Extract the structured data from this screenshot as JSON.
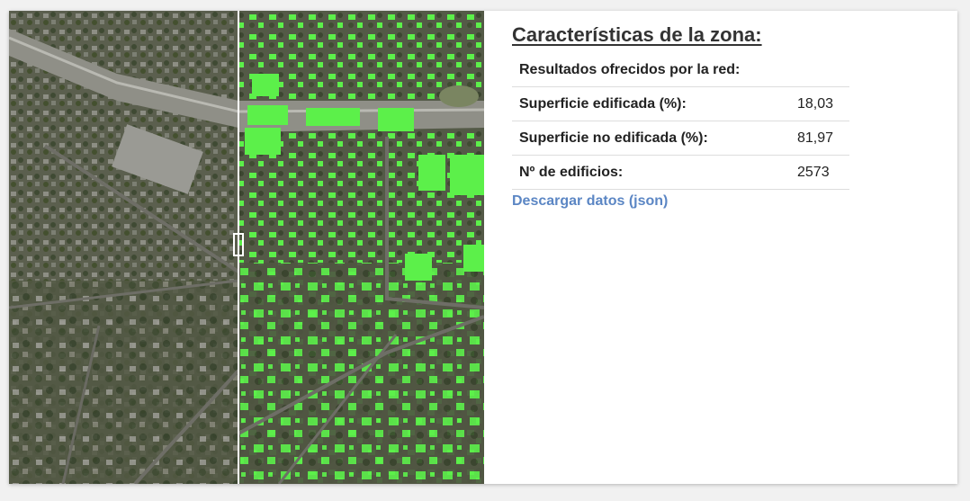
{
  "panel": {
    "title": "Características de la zona:",
    "results_header": "Resultados ofrecidos por la red:",
    "rows": [
      {
        "label": "Superficie edificada (%):",
        "value": "18,03"
      },
      {
        "label": "Superficie no edificada (%):",
        "value": "81,97"
      },
      {
        "label": "Nº de edificios:",
        "value": "2573"
      }
    ],
    "download_link": "Descargar datos (json)"
  },
  "map": {
    "left_view": "aerial-photo",
    "right_view": "building-detection-overlay",
    "overlay_color": "#5cf04a",
    "divider_color": "#ffffff"
  }
}
